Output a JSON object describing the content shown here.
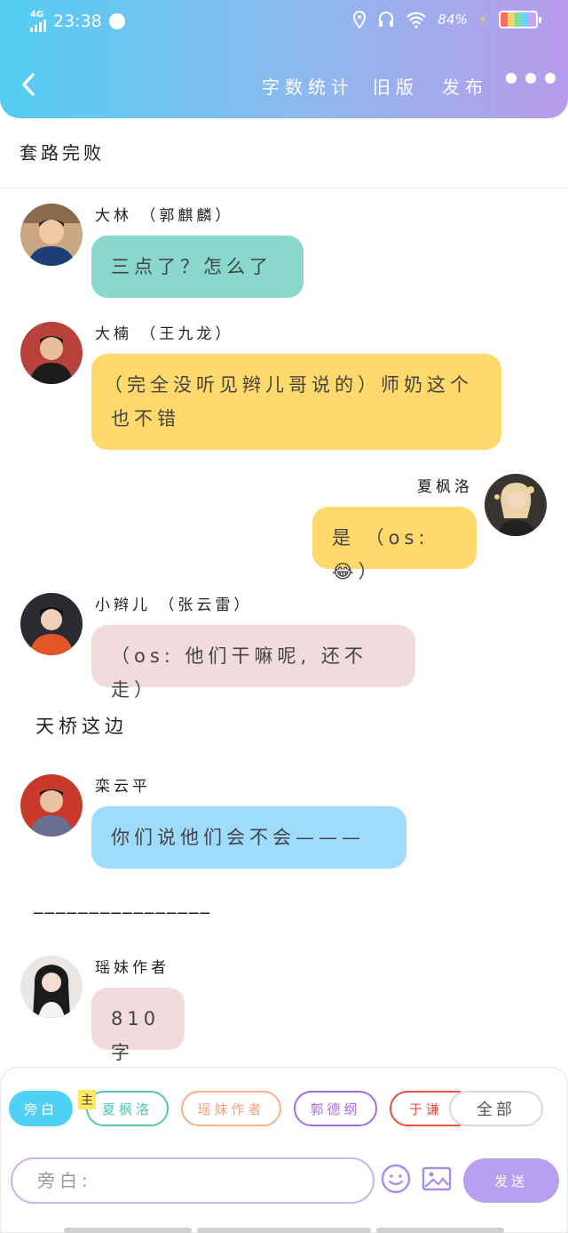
{
  "status_bar": {
    "network": "4G",
    "time": "23:38",
    "battery": "84%"
  },
  "header": {
    "nav": {
      "word_count": "字数统计",
      "old_version": "旧版",
      "publish": "发布"
    }
  },
  "title": "套路完败",
  "messages": [
    {
      "name": "大林 （郭麒麟）",
      "text": "三点了？怎么了"
    },
    {
      "name": "大楠 （王九龙）",
      "text_line1": "（完全没听见辫儿哥说的）师奶这个",
      "text_line2": "也不错"
    },
    {
      "name": "夏枫洛",
      "text": "是 （os:😂）"
    },
    {
      "name": "小辫儿 （张云雷）",
      "text": "（os: 他们干嘛呢, 还不走）"
    },
    {
      "name": "栾云平",
      "text": "你们说他们会不会———"
    },
    {
      "name": "瑶妹作者",
      "text": "810字"
    }
  ],
  "narrations": {
    "tianqiao": "天桥这边",
    "dashes": "________________"
  },
  "chips": {
    "narrator": "旁白",
    "main_tag": "主",
    "c1": "夏枫洛",
    "c2": "瑶妹作者",
    "c3": "郭德纲",
    "c4": "于谦",
    "all": "全部"
  },
  "composer": {
    "placeholder": "旁白:",
    "send": "发送"
  },
  "colors": {
    "header_start": "#52cdf3",
    "header_end": "#b89bec",
    "bubble_teal": "#89d7cd",
    "bubble_yellow": "#ffd96b",
    "bubble_pink": "#f1dbdd",
    "bubble_blue": "#9fdcfb",
    "send_button": "#b89ff0"
  }
}
